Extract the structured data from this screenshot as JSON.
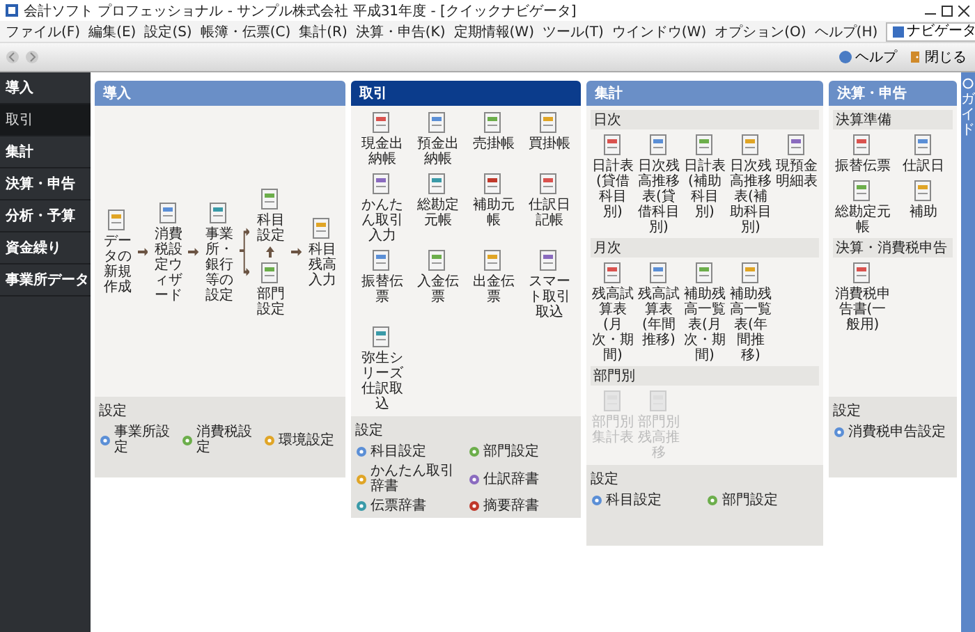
{
  "window": {
    "title": "会計ソフト プロフェッショナル - サンプル株式会社 平成31年度 - [クイックナビゲータ]"
  },
  "menu": [
    "ファイル(F)",
    "編集(E)",
    "設定(S)",
    "帳簿・伝票(C)",
    "集計(R)",
    "決算・申告(K)",
    "定期情報(W)",
    "ツール(T)",
    "ウインドウ(W)",
    "オプション(O)",
    "ヘルプ(H)"
  ],
  "toolbar": {
    "navigator": "ナビゲータ",
    "buttons": [
      "ヘルプ",
      "閉じる"
    ]
  },
  "sidebar": {
    "items": [
      {
        "label": "導入",
        "selected": false
      },
      {
        "label": "取引",
        "selected": true
      },
      {
        "label": "集計",
        "selected": false
      },
      {
        "label": "決算・申告",
        "selected": false
      },
      {
        "label": "分析・予算",
        "selected": false
      },
      {
        "label": "資金繰り",
        "selected": false
      },
      {
        "label": "事業所データ",
        "selected": false
      }
    ]
  },
  "panels": [
    {
      "title": "導入",
      "selected": false,
      "kind": "flow",
      "flow": [
        "データの新規作成",
        "消費税設定ウィザード",
        "事業所・銀行等の設定",
        "科目設定",
        "部門設定",
        "科目残高入力"
      ],
      "settings": {
        "title": "設定",
        "items": [
          "事業所設定",
          "消費税設定",
          "環境設定"
        ]
      }
    },
    {
      "title": "取引",
      "selected": true,
      "kind": "grid",
      "groups": [
        {
          "items": [
            {
              "label": "現金出納帳",
              "disabled": false
            },
            {
              "label": "預金出納帳",
              "disabled": false
            },
            {
              "label": "売掛帳",
              "disabled": false
            },
            {
              "label": "買掛帳",
              "disabled": false
            },
            {
              "label": "かんたん取引入力",
              "disabled": false
            },
            {
              "label": "総勘定元帳",
              "disabled": false
            },
            {
              "label": "補助元帳",
              "disabled": false
            },
            {
              "label": "仕訳日記帳",
              "disabled": false
            },
            {
              "label": "振替伝票",
              "disabled": false
            },
            {
              "label": "入金伝票",
              "disabled": false
            },
            {
              "label": "出金伝票",
              "disabled": false
            },
            {
              "label": "スマート取引取込",
              "disabled": false
            },
            {
              "label": "弥生シリーズ仕訳取込",
              "disabled": false
            }
          ]
        }
      ],
      "settings": {
        "title": "設定",
        "items": [
          "科目設定",
          "部門設定",
          "かんたん取引辞書",
          "仕訳辞書",
          "伝票辞書",
          "摘要辞書"
        ]
      }
    },
    {
      "title": "集計",
      "selected": false,
      "kind": "grid",
      "groups": [
        {
          "title": "日次",
          "items": [
            {
              "label": "日計表(貸借科目別)",
              "disabled": false
            },
            {
              "label": "日次残高推移表(貸借科目別)",
              "disabled": false
            },
            {
              "label": "日計表(補助科目別)",
              "disabled": false
            },
            {
              "label": "日次残高推移表(補助科目別)",
              "disabled": false
            },
            {
              "label": "現預金明細表",
              "disabled": false
            }
          ]
        },
        {
          "title": "月次",
          "items": [
            {
              "label": "残高試算表(月次・期間)",
              "disabled": false
            },
            {
              "label": "残高試算表(年間推移)",
              "disabled": false
            },
            {
              "label": "補助残高一覧表(月次・期間)",
              "disabled": false
            },
            {
              "label": "補助残高一覧表(年間推移)",
              "disabled": false
            }
          ]
        },
        {
          "title": "部門別",
          "items": [
            {
              "label": "部門別集計表",
              "disabled": true
            },
            {
              "label": "部門別残高推移",
              "disabled": true
            }
          ]
        }
      ],
      "settings": {
        "title": "設定",
        "items": [
          "科目設定",
          "部門設定"
        ]
      }
    },
    {
      "title": "決算・申告",
      "selected": false,
      "kind": "grid",
      "groups": [
        {
          "title": "決算準備",
          "items": [
            {
              "label": "振替伝票",
              "disabled": false
            },
            {
              "label": "仕訳日",
              "disabled": false
            },
            {
              "label": "総勘定元帳",
              "disabled": false
            },
            {
              "label": "補助",
              "disabled": false
            }
          ]
        },
        {
          "title": "決算・消費税申告",
          "items": [
            {
              "label": "消費税申告書(一般用)",
              "disabled": false
            }
          ]
        }
      ],
      "settings": {
        "title": "設定",
        "items": [
          "消費税申告設定"
        ]
      }
    }
  ],
  "guide": "ガイド"
}
